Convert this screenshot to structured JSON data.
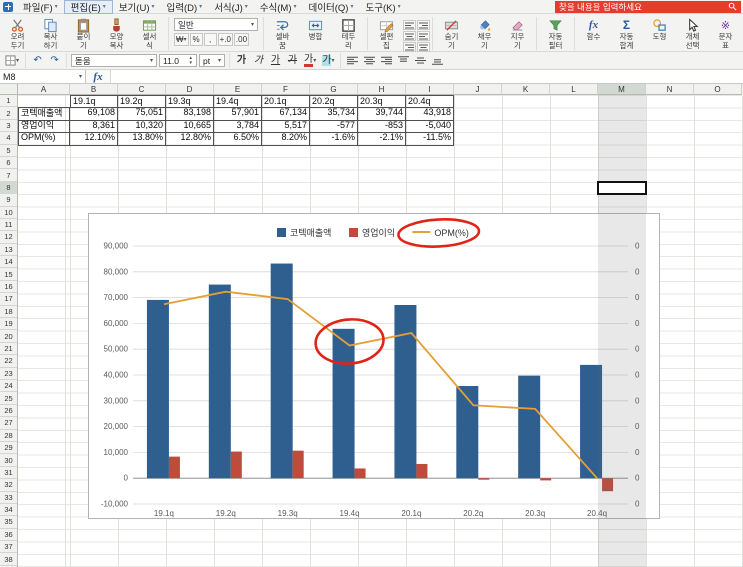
{
  "menu": {
    "items": [
      "파일(F)",
      "편집(E)",
      "보기(U)",
      "입력(D)",
      "서식(J)",
      "수식(M)",
      "데이터(Q)",
      "도구(K)"
    ]
  },
  "search": {
    "placeholder": "찾을 내용을 입력하세요"
  },
  "toolbar": {
    "cut": "오려두기",
    "copy": "복사하기",
    "paste": "붙이기",
    "painter": "모양복사",
    "cell_format": "셀서식",
    "number_format": "일반",
    "currency": "₩",
    "percent": "%",
    "comma": ",",
    "dec_add": "+.0",
    "dec_sub": ".00",
    "wrap": "셀바꿈",
    "merge": "병합",
    "border": "테두리",
    "cell_edit": "셀편집",
    "hide": "숨기기",
    "fill": "채우기",
    "clear": "지우기",
    "filter": "자동필터",
    "func": "함수",
    "autosum": "자동합계",
    "shapes": "도형",
    "select": "개체선택",
    "charmap": "문자표",
    "fx_icon": "fx",
    "sigma_icon": "Σ",
    "charmap_icon": "※"
  },
  "format": {
    "font": "돋움",
    "size": "11.0",
    "unit": "pt",
    "bold": "가",
    "italic": "가",
    "underline": "가",
    "strike": "가",
    "font_color": "가",
    "fill_color": "가"
  },
  "formula": {
    "name_box": "M8",
    "fx": "fx",
    "value": ""
  },
  "sheet": {
    "columns": [
      "A",
      "B",
      "C",
      "D",
      "E",
      "F",
      "G",
      "H",
      "I",
      "J",
      "K",
      "L",
      "M",
      "N",
      "O"
    ],
    "selected_column": "M",
    "selected_row": 8,
    "selected_cell": "M8",
    "rows": 38,
    "table": {
      "quarters": [
        "19.1q",
        "19.2q",
        "19.3q",
        "19.4q",
        "20.1q",
        "20.2q",
        "20.3q",
        "20.4q"
      ],
      "rows": [
        {
          "label": "코텍매출액",
          "values": [
            "69,108",
            "75,051",
            "83,198",
            "57,901",
            "67,134",
            "35,734",
            "39,744",
            "43,918"
          ]
        },
        {
          "label": "영업이익",
          "values": [
            "8,361",
            "10,320",
            "10,665",
            "3,784",
            "5,517",
            "-577",
            "-853",
            "-5,040"
          ]
        },
        {
          "label": "OPM(%)",
          "values": [
            "12.10%",
            "13.80%",
            "12.80%",
            "6.50%",
            "8.20%",
            "-1.6%",
            "-2.1%",
            "-11.5%"
          ]
        }
      ]
    }
  },
  "chart_data": {
    "type": "bar+line",
    "title": "",
    "categories": [
      "19.1q",
      "19.2q",
      "19.3q",
      "19.4q",
      "20.1q",
      "20.2q",
      "20.3q",
      "20.4q"
    ],
    "series": [
      {
        "name": "코텍매출액",
        "type": "bar",
        "axis": "left",
        "color": "#2f5f8f",
        "values": [
          69108,
          75051,
          83198,
          57901,
          67134,
          35734,
          39744,
          43918
        ]
      },
      {
        "name": "영업이익",
        "type": "bar",
        "axis": "left",
        "color": "#bf4b3c",
        "values": [
          8361,
          10320,
          10665,
          3784,
          5517,
          -577,
          -853,
          -5040
        ]
      },
      {
        "name": "OPM(%)",
        "type": "line",
        "axis": "right",
        "color": "#e49f36",
        "values": [
          12.1,
          13.8,
          12.8,
          6.5,
          8.2,
          -1.6,
          -2.1,
          -11.5
        ]
      }
    ],
    "left_axis": {
      "min": -10000,
      "max": 90000,
      "step": 10000,
      "labels": [
        "90,000",
        "80,000",
        "70,000",
        "60,000",
        "50,000",
        "40,000",
        "30,000",
        "20,000",
        "10,000",
        "0",
        "-10,000"
      ]
    },
    "right_axis": {
      "min": -15,
      "max": 20,
      "label_text": "0"
    },
    "legend_position": "top",
    "grid": true,
    "annotations": [
      "red circle around OPM(%) legend entry",
      "red circle around OPM line near 19.4q"
    ],
    "annotation_color": "#e02417"
  }
}
